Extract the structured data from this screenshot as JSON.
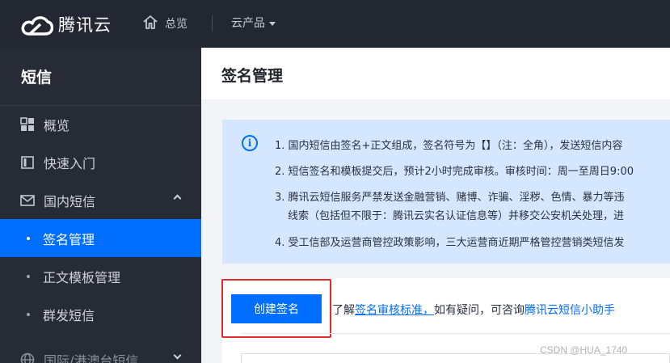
{
  "topbar": {
    "logo_text": "腾讯云",
    "overview_label": "总览",
    "products_label": "云产品"
  },
  "sidebar": {
    "title": "短信",
    "items": [
      {
        "label": "概览",
        "icon": "grid-icon"
      },
      {
        "label": "快速入门",
        "icon": "book-icon"
      },
      {
        "label": "国内短信",
        "icon": "mail-icon",
        "expanded": true
      },
      {
        "label": "签名管理",
        "active": true
      },
      {
        "label": "正文模板管理"
      },
      {
        "label": "群发短信"
      },
      {
        "label": "国际/港澳台短信",
        "icon": "globe-icon"
      }
    ]
  },
  "main": {
    "page_title": "签名管理",
    "notice": {
      "lines": [
        "1. 国内短信由签名+正文组成，签名符号为【】（注：全角），发送短信内容",
        "2. 短信签名和模板提交后，预计2小时完成审核。审核时间：周一至周日9:00",
        "3. 腾讯云短信服务严禁发送金融营销、赌博、诈骗、淫秽、色情、暴力等违",
        "线索（包括但不限于：腾讯云实名认证信息等）并移交公安机关处理，进",
        "4. 受工信部及运营商管控政策影响，三大运营商近期严格管控营销类短信发"
      ]
    },
    "create_button": "创建签名",
    "tip_prefix": "了解",
    "tip_link1": "签名审核标准，",
    "tip_middle": "如有疑问，可咨询",
    "tip_link2": "腾讯云短信小助手"
  },
  "watermark": "CSDN @HUA_1740",
  "colors": {
    "accent": "#006eff",
    "topbar_bg": "#232732",
    "sidebar_bg": "#262b36",
    "notice_bg": "#d5e7ff",
    "highlight": "#e42a2a"
  }
}
